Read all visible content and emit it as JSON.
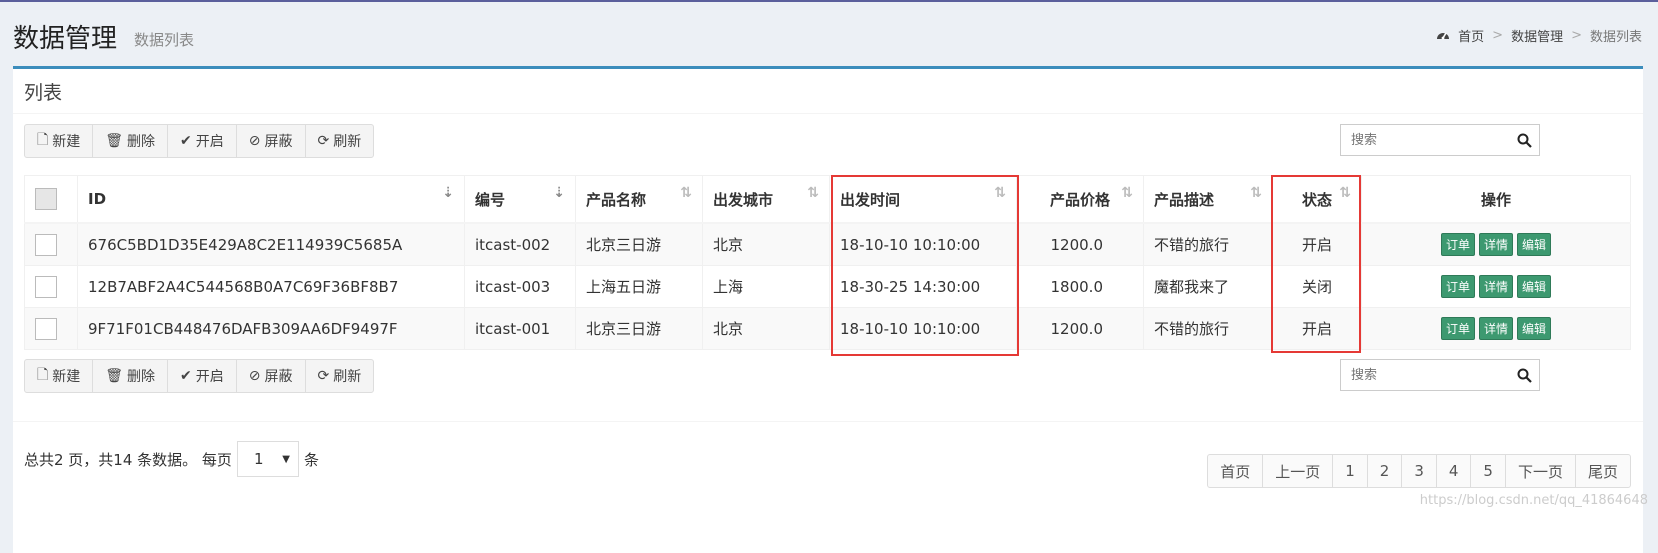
{
  "header": {
    "title": "数据管理",
    "subtitle": "数据列表"
  },
  "breadcrumb": {
    "home_icon": "dashboard-icon",
    "items": [
      "首页",
      "数据管理",
      "数据列表"
    ],
    "separator": ">"
  },
  "box": {
    "title": "列表"
  },
  "toolbar": {
    "buttons": [
      {
        "icon": "file-icon",
        "label": "新建"
      },
      {
        "icon": "trash-icon",
        "label": "删除"
      },
      {
        "icon": "check-icon",
        "label": "开启"
      },
      {
        "icon": "ban-icon",
        "label": "屏蔽"
      },
      {
        "icon": "refresh-icon",
        "label": "刷新"
      }
    ]
  },
  "search": {
    "placeholder": "搜索",
    "icon": "search-icon"
  },
  "table": {
    "columns": [
      "ID",
      "编号",
      "产品名称",
      "出发城市",
      "出发时间",
      "产品价格",
      "产品描述",
      "状态",
      "操作"
    ],
    "rows": [
      {
        "id": "676C5BD1D35E429A8C2E114939C5685A",
        "code": "itcast-002",
        "name": "北京三日游",
        "city": "北京",
        "time": "18-10-10 10:10:00",
        "price": "1200.0",
        "desc": "不错的旅行",
        "status": "开启"
      },
      {
        "id": "12B7ABF2A4C544568B0A7C69F36BF8B7",
        "code": "itcast-003",
        "name": "上海五日游",
        "city": "上海",
        "time": "18-30-25 14:30:00",
        "price": "1800.0",
        "desc": "魔都我来了",
        "status": "关闭"
      },
      {
        "id": "9F71F01CB448476DAFB309AA6DF9497F",
        "code": "itcast-001",
        "name": "北京三日游",
        "city": "北京",
        "time": "18-10-10 10:10:00",
        "price": "1200.0",
        "desc": "不错的旅行",
        "status": "开启"
      }
    ],
    "actions": [
      "订单",
      "详情",
      "编辑"
    ]
  },
  "pager": {
    "summary": "总共2 页，共14 条数据。 每页",
    "page_size": "1",
    "suffix": "条",
    "pages": [
      "首页",
      "上一页",
      "1",
      "2",
      "3",
      "4",
      "5",
      "下一页",
      "尾页"
    ]
  },
  "watermark": "https://blog.csdn.net/qq_41864648",
  "colors": {
    "accent": "#3c8dbc",
    "action_button": "#3d9970",
    "highlight": "#e53935"
  }
}
